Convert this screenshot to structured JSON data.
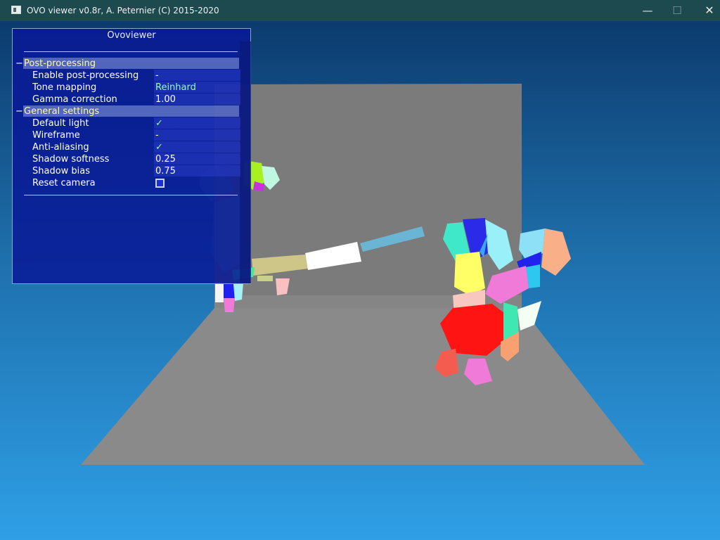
{
  "window": {
    "title": "OVO viewer v0.8r, A. Peternier (C) 2015-2020",
    "minimize_glyph": "—",
    "maximize_glyph": "☐",
    "close_glyph": "✕"
  },
  "panel": {
    "title": "Ovoviewer",
    "sections": [
      {
        "toggle": "−",
        "title": "Post-processing",
        "rows": [
          {
            "label": "Enable post-processing",
            "value": "-"
          },
          {
            "label": "Tone mapping",
            "value": "Reinhard"
          },
          {
            "label": "Gamma correction",
            "value": "1.00"
          }
        ]
      },
      {
        "toggle": "−",
        "title": "General settings",
        "rows": [
          {
            "label": "Default light",
            "value": "✓"
          },
          {
            "label": "Wireframe",
            "value": "-"
          },
          {
            "label": "Anti-aliasing",
            "value": "✓"
          },
          {
            "label": "Shadow softness",
            "value": "0.25"
          },
          {
            "label": "Shadow bias",
            "value": "0.75"
          },
          {
            "label": "Reset camera",
            "value": ""
          }
        ]
      }
    ]
  },
  "colors": {
    "titlebar": "#1d4a4f",
    "floor": "#8a8a8a",
    "wall": "#7c7c7c",
    "section_text": "#ffff90",
    "value_highlight": "#9aff9a"
  }
}
